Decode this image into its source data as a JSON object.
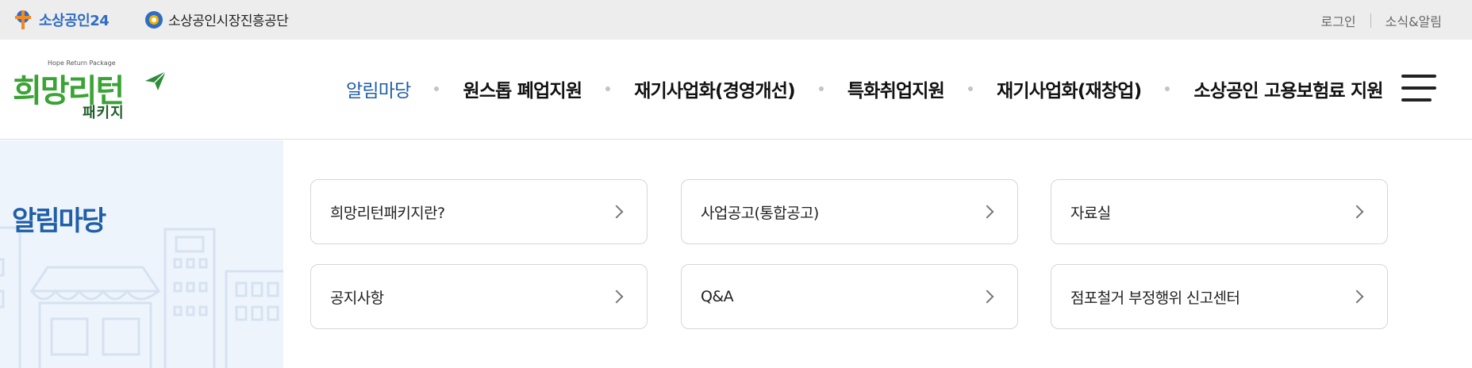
{
  "topbar": {
    "logo_semas24": "소상공인24",
    "logo_semas": "소상공인시장진흥공단",
    "login": "로그인",
    "news": "소식&알림"
  },
  "brand": {
    "subtitle": "Hope Return Package",
    "title": "희망리턴",
    "package": "패키지"
  },
  "gnb": [
    {
      "label": "알림마당",
      "active": true
    },
    {
      "label": "원스톱 폐업지원"
    },
    {
      "label": "재기사업화(경영개선)"
    },
    {
      "label": "특화취업지원"
    },
    {
      "label": "재기사업화(재창업)"
    },
    {
      "label": "소상공인 고용보험료 지원"
    }
  ],
  "side": {
    "title": "알림마당"
  },
  "cards": [
    {
      "label": "희망리턴패키지란?"
    },
    {
      "label": "사업공고(통합공고)"
    },
    {
      "label": "자료실"
    },
    {
      "label": "공지사항"
    },
    {
      "label": "Q&A"
    },
    {
      "label": "점포철거 부정행위 신고센터"
    }
  ],
  "colors": {
    "accent": "#1f5ea8",
    "brand_green": "#3aa335",
    "topbar_bg": "#ededed",
    "side_bg": "#eef4fb"
  }
}
